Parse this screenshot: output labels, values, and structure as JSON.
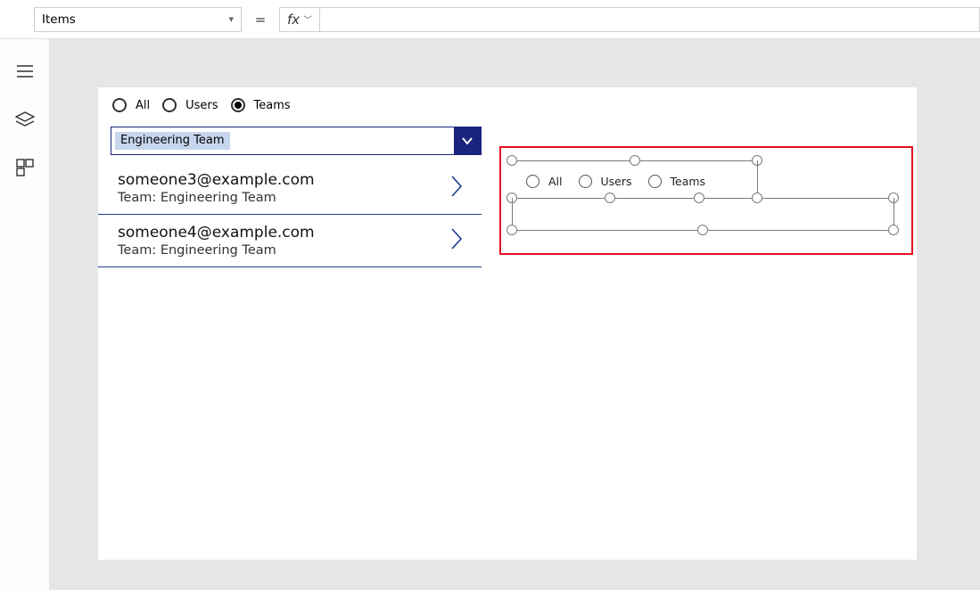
{
  "formula_bar": {
    "property": "Items",
    "equals": "=",
    "fx_label": "fx",
    "formula": ""
  },
  "left_radios": {
    "options": [
      "All",
      "Users",
      "Teams"
    ],
    "selected_index": 2
  },
  "dropdown": {
    "selected": "Engineering Team"
  },
  "gallery": [
    {
      "title": "someone3@example.com",
      "subtitle": "Team: Engineering Team"
    },
    {
      "title": "someone4@example.com",
      "subtitle": "Team: Engineering Team"
    }
  ],
  "design_radios": {
    "options": [
      "All",
      "Users",
      "Teams"
    ]
  }
}
